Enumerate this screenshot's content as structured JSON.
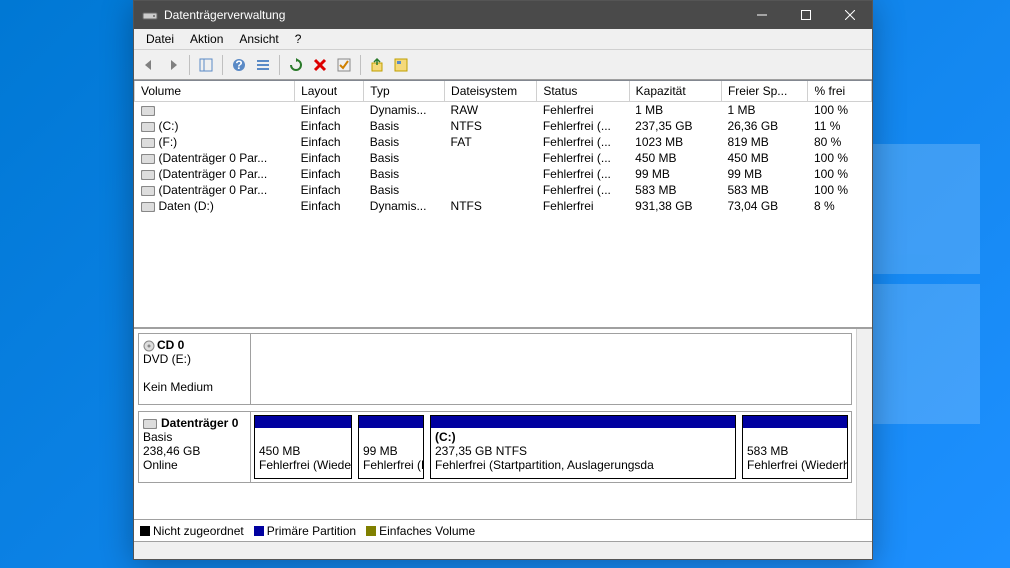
{
  "window": {
    "title": "Datenträgerverwaltung"
  },
  "menubar": {
    "items": [
      "Datei",
      "Aktion",
      "Ansicht",
      "?"
    ]
  },
  "table": {
    "columns": [
      "Volume",
      "Layout",
      "Typ",
      "Dateisystem",
      "Status",
      "Kapazität",
      "Freier Sp...",
      "% frei"
    ],
    "rows": [
      {
        "name": "",
        "layout": "Einfach",
        "typ": "Dynamis...",
        "fs": "RAW",
        "status": "Fehlerfrei",
        "cap": "1 MB",
        "free": "1 MB",
        "pct": "100 %"
      },
      {
        "name": "(C:)",
        "layout": "Einfach",
        "typ": "Basis",
        "fs": "NTFS",
        "status": "Fehlerfrei (...",
        "cap": "237,35 GB",
        "free": "26,36 GB",
        "pct": "11 %"
      },
      {
        "name": "(F:)",
        "layout": "Einfach",
        "typ": "Basis",
        "fs": "FAT",
        "status": "Fehlerfrei (...",
        "cap": "1023 MB",
        "free": "819 MB",
        "pct": "80 %"
      },
      {
        "name": "(Datenträger 0 Par...",
        "layout": "Einfach",
        "typ": "Basis",
        "fs": "",
        "status": "Fehlerfrei (...",
        "cap": "450 MB",
        "free": "450 MB",
        "pct": "100 %"
      },
      {
        "name": "(Datenträger 0 Par...",
        "layout": "Einfach",
        "typ": "Basis",
        "fs": "",
        "status": "Fehlerfrei (...",
        "cap": "99 MB",
        "free": "99 MB",
        "pct": "100 %"
      },
      {
        "name": "(Datenträger 0 Par...",
        "layout": "Einfach",
        "typ": "Basis",
        "fs": "",
        "status": "Fehlerfrei (...",
        "cap": "583 MB",
        "free": "583 MB",
        "pct": "100 %"
      },
      {
        "name": "Daten (D:)",
        "layout": "Einfach",
        "typ": "Dynamis...",
        "fs": "NTFS",
        "status": "Fehlerfrei",
        "cap": "931,38 GB",
        "free": "73,04 GB",
        "pct": "8 %"
      }
    ]
  },
  "graphical": {
    "cd": {
      "title": "CD 0",
      "sub": "DVD (E:)",
      "status": "Kein Medium"
    },
    "disk0": {
      "title": "Datenträger 0",
      "type": "Basis",
      "size": "238,46 GB",
      "status": "Online",
      "parts": [
        {
          "label": "",
          "lines": [
            "450 MB",
            "Fehlerfrei (Wiederh"
          ]
        },
        {
          "label": "",
          "lines": [
            "99 MB",
            "Fehlerfrei (EF"
          ]
        },
        {
          "label": "(C:)",
          "lines": [
            "237,35 GB NTFS",
            "Fehlerfrei (Startpartition, Auslagerungsda"
          ]
        },
        {
          "label": "",
          "lines": [
            "583 MB",
            "Fehlerfrei (Wiederhe"
          ]
        }
      ]
    }
  },
  "legend": {
    "items": [
      {
        "color": "#000000",
        "label": "Nicht zugeordnet"
      },
      {
        "color": "#0000a0",
        "label": "Primäre Partition"
      },
      {
        "color": "#808000",
        "label": "Einfaches Volume"
      }
    ]
  }
}
